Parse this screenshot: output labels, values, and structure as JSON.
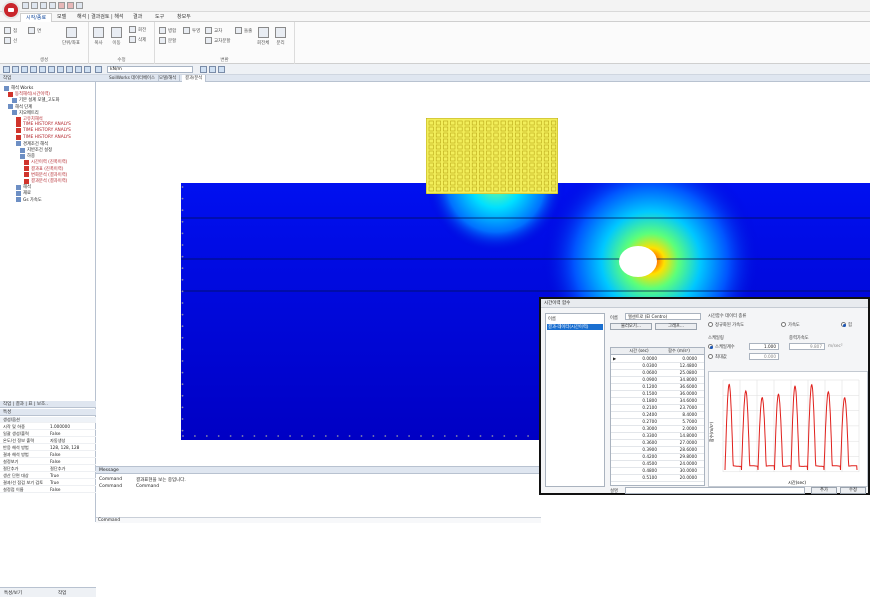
{
  "menu": {
    "tabs": [
      "시작/종료",
      "모델",
      "해석 | 결과검토 | 해석",
      "결과",
      "도구",
      "창모두"
    ]
  },
  "ribbon": {
    "groups": [
      "생성",
      "수정",
      "변환"
    ],
    "buttons": [
      "점",
      "선",
      "면",
      "단위/좌표",
      "복사",
      "이동",
      "회전",
      "삭제",
      "병합",
      "분할",
      "투영",
      "교차",
      "교차분할",
      "돌출",
      "회전체",
      "분리",
      "추출"
    ]
  },
  "toolstrip": {
    "units_value": "kN/m"
  },
  "left_panel": {
    "header": "작업",
    "tree": [
      {
        "label": "해석 Works",
        "red": false
      },
      {
        "label": "동적해석(시간이력)",
        "red": true
      },
      {
        "label": "기본 설계 모델_고도화",
        "red": false
      },
      {
        "label": "해석 단계",
        "red": false
      },
      {
        "label": "지오메트리",
        "red": false
      },
      {
        "label": "고유치해석",
        "red": true
      },
      {
        "label": "TIME HISTORY ANALYS",
        "red": true
      },
      {
        "label": "TIME HISTORY ANALYS",
        "red": true
      },
      {
        "label": "TIME HISTORY ANALYS",
        "red": true
      },
      {
        "label": "경계조건 해석",
        "red": false
      },
      {
        "label": "지반조건 설정",
        "red": false
      },
      {
        "label": "하중",
        "red": false
      },
      {
        "label": "시간이력 (진폭이력)",
        "red": true
      },
      {
        "label": "결과표 (진폭이력)",
        "red": true
      },
      {
        "label": "변화분석 (결과이력)",
        "red": true
      },
      {
        "label": "결과분석 (결과이력)",
        "red": true
      },
      {
        "label": "해석",
        "red": false
      },
      {
        "label": "재료",
        "red": false
      },
      {
        "label": "Gs 가속도",
        "red": false
      }
    ],
    "tabs_header": "작업 | 결과 | 표 | 보조..",
    "props_header": "특성",
    "props_group": "생성/옵션",
    "props": [
      [
        "시작 및 하중",
        "1.000000"
      ],
      [
        "일괄 생성/출력",
        "False"
      ],
      [
        "온도/선 정보 출력",
        "자동생성"
      ],
      [
        "반응 해석 방법",
        "128, 128, 128"
      ],
      [
        "결과 해석 방법",
        "False"
      ],
      [
        "설정보기",
        "False"
      ],
      [
        "절단추가",
        "절단추가"
      ],
      [
        "생산 단면 대상",
        "True"
      ],
      [
        "결과/선 점검 보기 검토",
        "True"
      ],
      [
        "설정점 이름",
        "False"
      ]
    ],
    "bottom_tabs": [
      "특성/보기",
      "작업"
    ]
  },
  "view_tabs": [
    "SoilWorks 데이터베이스",
    "모델/해석",
    "결과/분석"
  ],
  "message": {
    "header": "Message",
    "lines": [
      {
        "left": "Command",
        "right": "결과표현을 보는 중입니다."
      },
      {
        "left": "Command",
        "right": "Command"
      }
    ],
    "command_label": "Command"
  },
  "dialog": {
    "title": "시간이력 함수",
    "list_header": "이름",
    "list_item": "결과-데이터(시간이력)",
    "name_label": "이름",
    "name_value": "엘센트로 (El Centro)",
    "import_btn": "불러오기...",
    "graph_btn": "그래프...",
    "col_time": "시간 (sec)",
    "col_func": "함수 (m/s²)",
    "rows": [
      [
        "0.0000",
        "0.0000"
      ],
      [
        "0.0300",
        "12.4800"
      ],
      [
        "0.0600",
        "25.0800"
      ],
      [
        "0.0900",
        "34.8000"
      ],
      [
        "0.1200",
        "36.6000"
      ],
      [
        "0.1500",
        "36.0000"
      ],
      [
        "0.1800",
        "34.6000"
      ],
      [
        "0.2100",
        "23.7000"
      ],
      [
        "0.2400",
        "8.4000"
      ],
      [
        "0.2700",
        "5.7000"
      ],
      [
        "0.3000",
        "2.0000"
      ],
      [
        "0.3300",
        "14.8000"
      ],
      [
        "0.3600",
        "27.0000"
      ],
      [
        "0.3900",
        "28.6000"
      ],
      [
        "0.4200",
        "29.8000"
      ],
      [
        "0.4500",
        "24.0000"
      ],
      [
        "0.4800",
        "30.0000"
      ],
      [
        "0.5100",
        "20.0000"
      ]
    ],
    "data_type_label": "시간함수 데이터 종류",
    "data_types": [
      "정규화된 가속도",
      "가속도",
      "힘"
    ],
    "scale_label": "스케일링",
    "scale_options": [
      "스케일계수",
      "최대값"
    ],
    "scale_value": "1.000",
    "max_value": "0.000",
    "gravity_label": "중력가속도",
    "gravity_value": "9.807",
    "gravity_unit": "m/sec²",
    "graph_ylabel": "함수(m/s²)",
    "graph_xlabel": "시간(sec)",
    "note_label": "설명",
    "add_btn": "추가",
    "edit_btn": "수정"
  },
  "colors": {
    "accent": "#1b4fa0",
    "soil_low": "#0000d8",
    "soil_high": "#ff2a00",
    "building": "#f2ee5a"
  }
}
